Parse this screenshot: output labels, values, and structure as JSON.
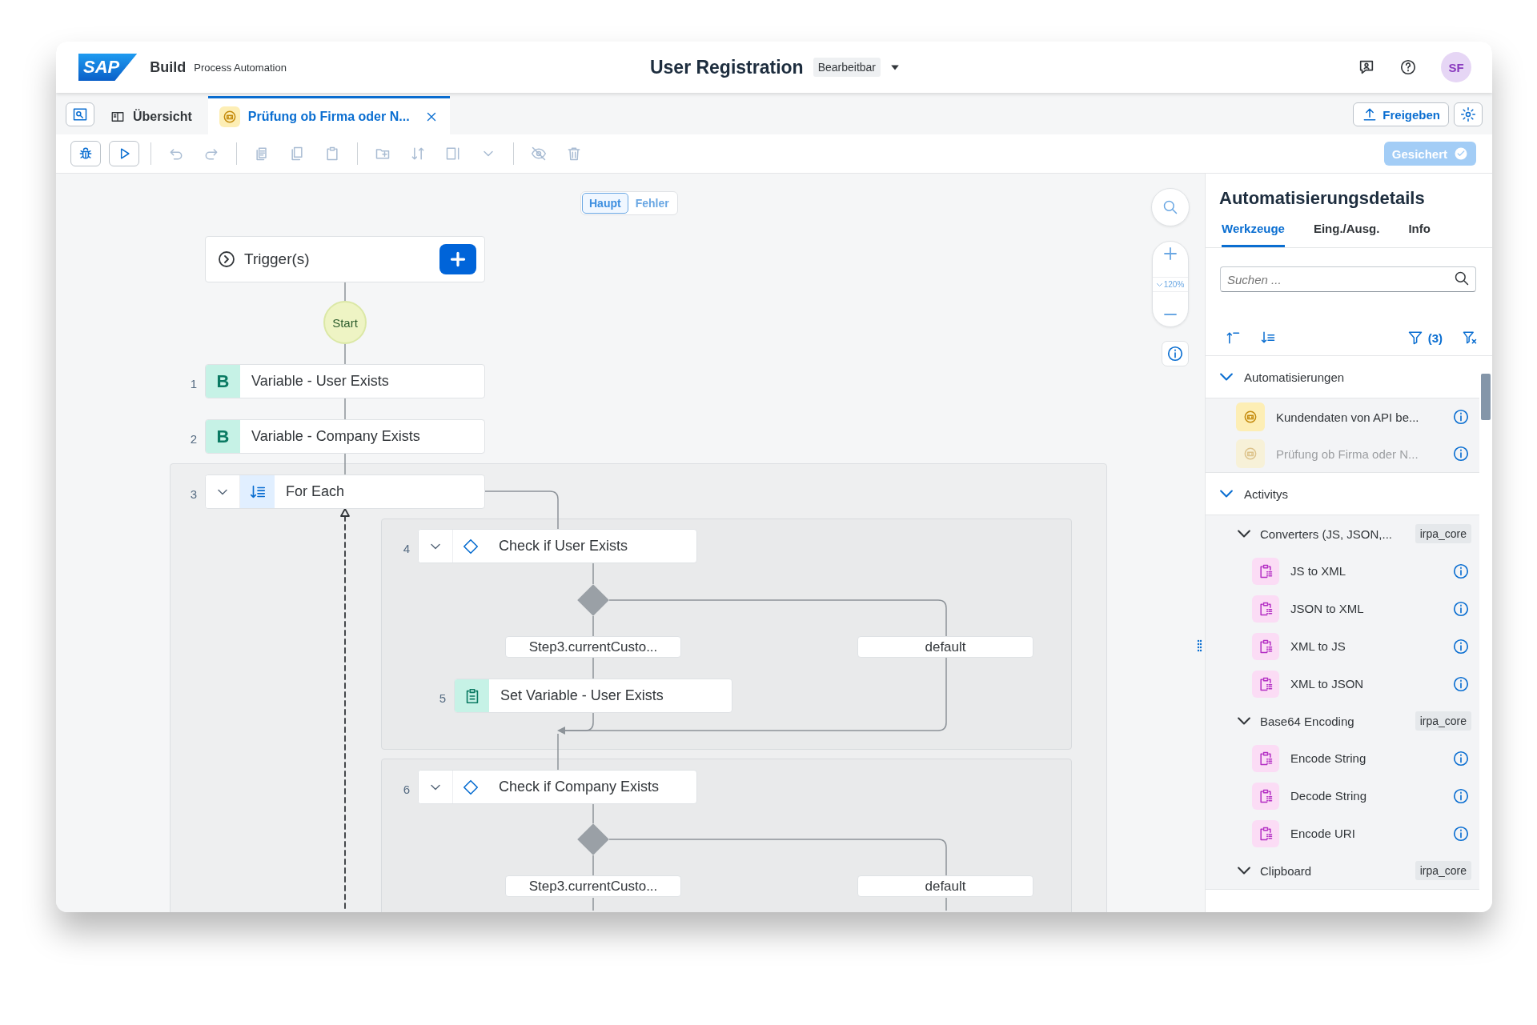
{
  "header": {
    "logo": "SAP",
    "product": "Build",
    "subproduct": "Process Automation",
    "title": "User Registration",
    "status": "Bearbeitbar",
    "avatar": "SF"
  },
  "tabs": [
    {
      "label": "Übersicht",
      "kind": "overview",
      "selected": false
    },
    {
      "label": "Prüfung ob Firma oder N...",
      "kind": "automation",
      "selected": true
    }
  ],
  "share_button": "Freigeben",
  "toolbar": [
    [
      {
        "kind": "debug",
        "disabled": false
      },
      {
        "kind": "run",
        "disabled": false
      }
    ],
    [
      {
        "kind": "undo",
        "disabled": true
      },
      {
        "kind": "redo",
        "disabled": true
      }
    ],
    [
      {
        "kind": "copy-step",
        "disabled": true
      },
      {
        "kind": "copy",
        "disabled": true
      },
      {
        "kind": "paste",
        "disabled": true
      }
    ],
    [
      {
        "kind": "add-folder",
        "disabled": true
      },
      {
        "kind": "sort",
        "disabled": true
      },
      {
        "kind": "select",
        "disabled": true
      },
      {
        "kind": "dropdown",
        "disabled": true
      }
    ],
    [
      {
        "kind": "hide",
        "disabled": true
      },
      {
        "kind": "delete",
        "disabled": true
      }
    ]
  ],
  "saved_button": {
    "label": "Gesichert",
    "disabled": true
  },
  "canvas": {
    "modes": [
      {
        "label": "Haupt",
        "selected": true
      },
      {
        "label": "Fehler",
        "selected": false
      }
    ],
    "trigger": "Trigger(s)",
    "start": "Start",
    "zoom": "120%",
    "steps": [
      {
        "number": "1",
        "kind": "variable",
        "badge": "B",
        "label": "Variable - User Exists"
      },
      {
        "number": "2",
        "kind": "variable",
        "badge": "B",
        "label": "Variable - Company Exists"
      },
      {
        "number": "3",
        "kind": "loop",
        "label": "For Each",
        "expanded": true
      },
      {
        "number": "4",
        "kind": "condition",
        "label": "Check if User Exists",
        "expanded": true,
        "branches": [
          "Step3.currentCusto...",
          "default"
        ]
      },
      {
        "number": "5",
        "kind": "set",
        "label": "Set Variable - User Exists"
      },
      {
        "number": "6",
        "kind": "condition",
        "label": "Check if Company Exists",
        "expanded": true,
        "branches": [
          "Step3.currentCusto...",
          "default"
        ]
      }
    ]
  },
  "panel": {
    "title": "Automatisierungsdetails",
    "tabs": [
      {
        "label": "Werkzeuge",
        "selected": true
      },
      {
        "label": "Eing./Ausg.",
        "selected": false
      },
      {
        "label": "Info",
        "selected": false
      }
    ],
    "search": {
      "placeholder": "Suchen ..."
    },
    "filter_count": "(3)",
    "tree": [
      {
        "label": "Automatisierungen",
        "expanded": true,
        "children": [
          {
            "kind": "automation",
            "label": "Kundendaten von API be...",
            "disabled": false
          },
          {
            "kind": "automation",
            "label": "Prüfung ob Firma oder N...",
            "disabled": true
          }
        ]
      },
      {
        "label": "Activitys",
        "expanded": true,
        "children": [
          {
            "kind": "group",
            "label": "Converters (JS, JSON,...",
            "tag": "irpa_core",
            "expanded": true,
            "children": [
              {
                "kind": "activity",
                "label": "JS to XML",
                "disabled": false
              },
              {
                "kind": "activity",
                "label": "JSON to XML",
                "disabled": false
              },
              {
                "kind": "activity",
                "label": "XML to JS",
                "disabled": false
              },
              {
                "kind": "activity",
                "label": "XML to JSON",
                "disabled": false
              }
            ]
          },
          {
            "kind": "group",
            "label": "Base64 Encoding",
            "tag": "irpa_core",
            "expanded": true,
            "children": [
              {
                "kind": "activity",
                "label": "Encode String",
                "disabled": false
              },
              {
                "kind": "activity",
                "label": "Decode String",
                "disabled": false
              },
              {
                "kind": "activity",
                "label": "Encode URI",
                "disabled": false
              }
            ]
          },
          {
            "kind": "group",
            "label": "Clipboard",
            "tag": "irpa_core",
            "expanded": true
          }
        ]
      }
    ]
  }
}
